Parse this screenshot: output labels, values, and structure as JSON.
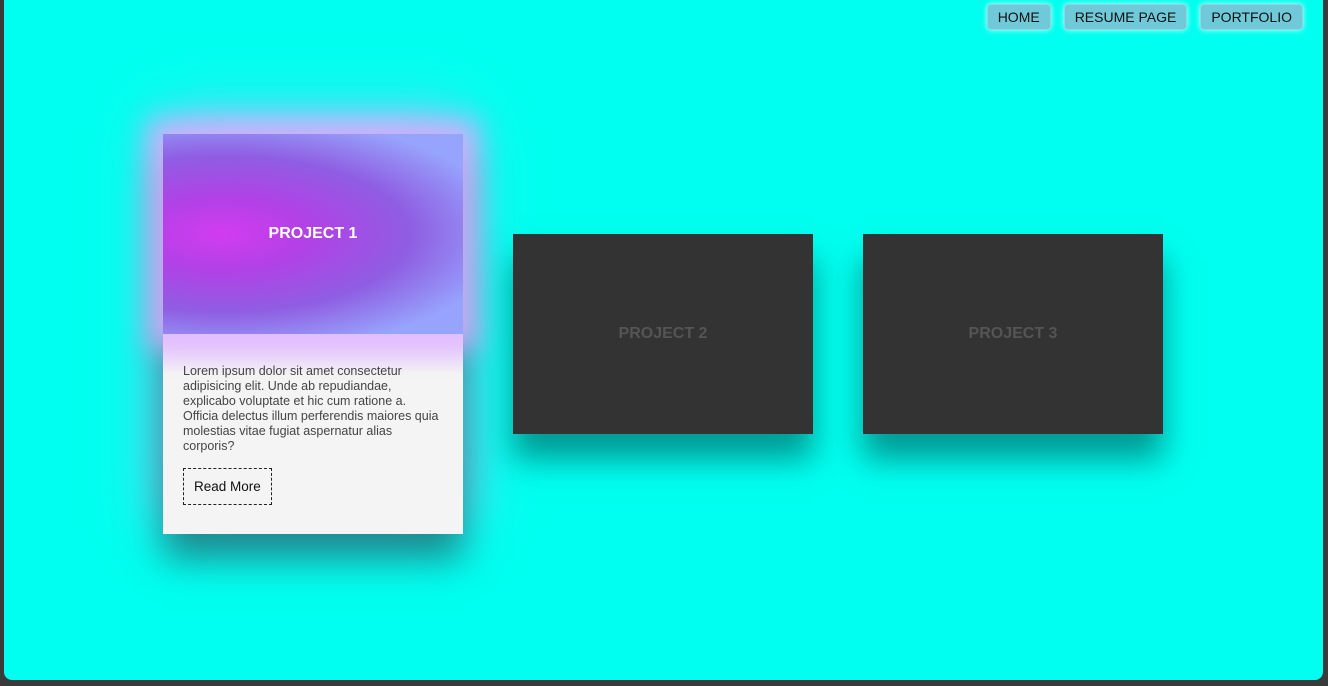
{
  "nav": {
    "items": [
      {
        "label": "HOME"
      },
      {
        "label": "RESUME PAGE"
      },
      {
        "label": "PORTFOLIO"
      }
    ]
  },
  "projects": [
    {
      "title": "PROJECT 1",
      "description": "Lorem ipsum dolor sit amet consectetur adipisicing elit. Unde ab repudiandae, explicabo voluptate et hic cum ratione a. Officia delectus illum perferendis maiores quia molestias vitae fugiat aspernatur alias corporis?",
      "button_label": "Read More"
    },
    {
      "title": "PROJECT 2"
    },
    {
      "title": "PROJECT 3"
    }
  ],
  "colors": {
    "background": "#00fff0",
    "card_dark": "#333333",
    "card_light": "#f4f4f4",
    "accent_purple": "#b43ce6",
    "nav_button": "#6fc9d8"
  }
}
